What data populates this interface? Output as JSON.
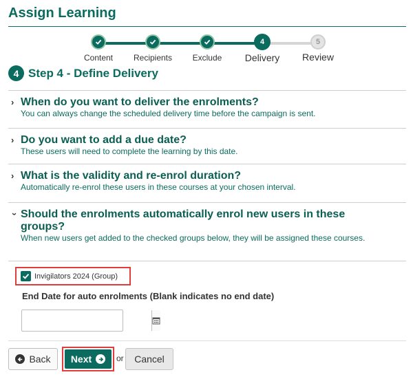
{
  "page": {
    "title": "Assign Learning"
  },
  "stepper": {
    "steps": [
      {
        "label": "Content",
        "state": "done",
        "icon": "check-icon"
      },
      {
        "label": "Recipients",
        "state": "done",
        "icon": "check-icon"
      },
      {
        "label": "Exclude",
        "state": "done",
        "icon": "check-icon"
      },
      {
        "label": "Delivery",
        "state": "current",
        "number": "4"
      },
      {
        "label": "Review",
        "state": "future",
        "number": "5"
      }
    ]
  },
  "step_heading": {
    "number": "4",
    "text": "Step 4 - Define Delivery"
  },
  "sections": [
    {
      "title": "When do you want to deliver the enrolments?",
      "subtitle": "You can always change the scheduled delivery time before the campaign is sent.",
      "expanded": false
    },
    {
      "title": "Do you want to add a due date?",
      "subtitle": "These users will need to complete the learning by this date.",
      "expanded": false
    },
    {
      "title": "What is the validity and re-enrol duration?",
      "subtitle": "Automatically re-enrol these users in these courses at your chosen interval.",
      "expanded": false
    },
    {
      "title": "Should the enrolments automatically enrol new users in these groups?",
      "subtitle": "When new users get added to the checked groups below, they will be assigned these courses.",
      "expanded": true
    }
  ],
  "auto_enrol": {
    "group_label": "Invigilators 2024 (Group)",
    "group_checked": true,
    "end_date_label": "End Date for auto enrolments (Blank indicates no end date)",
    "end_date_value": ""
  },
  "buttons": {
    "back": "Back",
    "next": "Next",
    "or": "or",
    "cancel": "Cancel"
  },
  "colors": {
    "accent": "#0b6b5e",
    "highlight": "#e03c3c",
    "step_ring": "#8fc7a2"
  }
}
